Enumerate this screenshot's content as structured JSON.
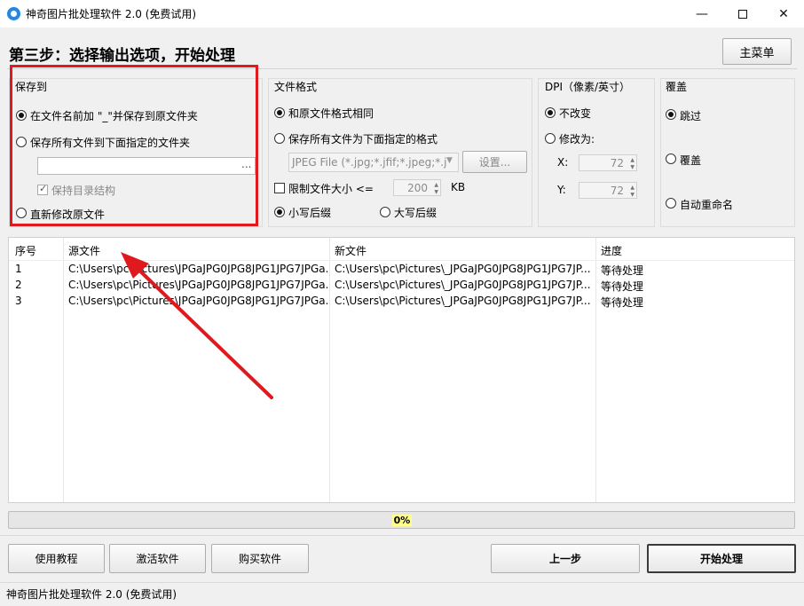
{
  "window": {
    "title": "神奇图片批处理软件 2.0 (免费试用)",
    "minimize": "—",
    "close": "✕"
  },
  "header": {
    "step_title": "第三步：选择输出选项，开始处理",
    "main_menu": "主菜单"
  },
  "save_to": {
    "title": "保存到",
    "options": [
      {
        "label": "在文件名前加 \"_\"并保存到原文件夹",
        "selected": true
      },
      {
        "label": "保存所有文件到下面指定的文件夹",
        "selected": false
      },
      {
        "label": "直新修改原文件",
        "selected": false
      }
    ],
    "folder_path": "",
    "browse": "...",
    "keep_structure": "保持目录结构"
  },
  "file_format": {
    "title": "文件格式",
    "same_format": "和原文件格式相同",
    "save_as_format": "保存所有文件为下面指定的格式",
    "format_select": "JPEG File (*.jpg;*.jfif;*.jpeg;*.j",
    "settings_button": "设置...",
    "limit_size": "限制文件大小  <=",
    "limit_value": "200",
    "limit_unit": "KB",
    "lowercase_ext": "小写后缀",
    "uppercase_ext": "大写后缀"
  },
  "dpi": {
    "title": "DPI（像素/英寸）",
    "no_change": "不改变",
    "change_to": "修改为:",
    "x_label": "X:",
    "x_value": "72",
    "y_label": "Y:",
    "y_value": "72"
  },
  "overwrite": {
    "title": "覆盖",
    "skip": "跳过",
    "overwrite": "覆盖",
    "auto_rename": "自动重命名"
  },
  "table": {
    "columns": [
      "序号",
      "源文件",
      "新文件",
      "进度"
    ],
    "rows": [
      {
        "index": "1",
        "source": "C:\\Users\\pc\\Pictures\\JPGaJPG0JPG8JPG1JPG7JPGa...",
        "target": "C:\\Users\\pc\\Pictures\\_JPGaJPG0JPG8JPG1JPG7JP...",
        "status": "等待处理"
      },
      {
        "index": "2",
        "source": "C:\\Users\\pc\\Pictures\\JPGaJPG0JPG8JPG1JPG7JPGa...",
        "target": "C:\\Users\\pc\\Pictures\\_JPGaJPG0JPG8JPG1JPG7JP...",
        "status": "等待处理"
      },
      {
        "index": "3",
        "source": "C:\\Users\\pc\\Pictures\\JPGaJPG0JPG8JPG1JPG7JPGa...",
        "target": "C:\\Users\\pc\\Pictures\\_JPGaJPG0JPG8JPG1JPG7JP...",
        "status": "等待处理"
      }
    ]
  },
  "progress": {
    "label": "0%",
    "value": 0
  },
  "footer": {
    "tutorial": "使用教程",
    "activate": "激活软件",
    "buy": "购买软件",
    "prev": "上一步",
    "start": "开始处理"
  },
  "status_bar": {
    "text": "神奇图片批处理软件 2.0 (免费试用)"
  },
  "colors": {
    "highlight_red": "#e0191e",
    "progress_label_bg": "#ffff8a"
  }
}
